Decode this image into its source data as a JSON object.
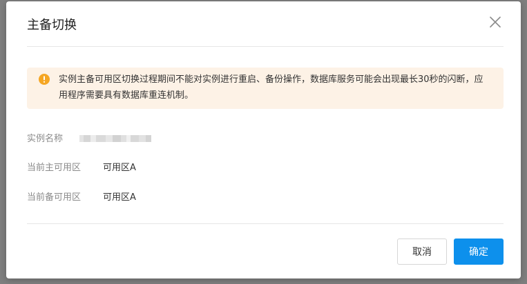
{
  "dialog": {
    "title": "主备切换",
    "close_icon": "close-icon"
  },
  "alert": {
    "icon": "warning-icon",
    "icon_color": "#f5a623",
    "background": "#fdf2e6",
    "text": "实例主备可用区切换过程期间不能对实例进行重启、备份操作，数据库服务可能会出现最长30秒的闪断，应用程序需要具有数据库重连机制。"
  },
  "fields": {
    "instance_name": {
      "label": "实例名称"
    },
    "current_primary_zone": {
      "label": "当前主可用区",
      "value": "可用区A"
    },
    "current_standby_zone": {
      "label": "当前备可用区",
      "value": "可用区A"
    }
  },
  "footer": {
    "cancel_label": "取消",
    "confirm_label": "确定",
    "confirm_color": "#0d90ec"
  }
}
